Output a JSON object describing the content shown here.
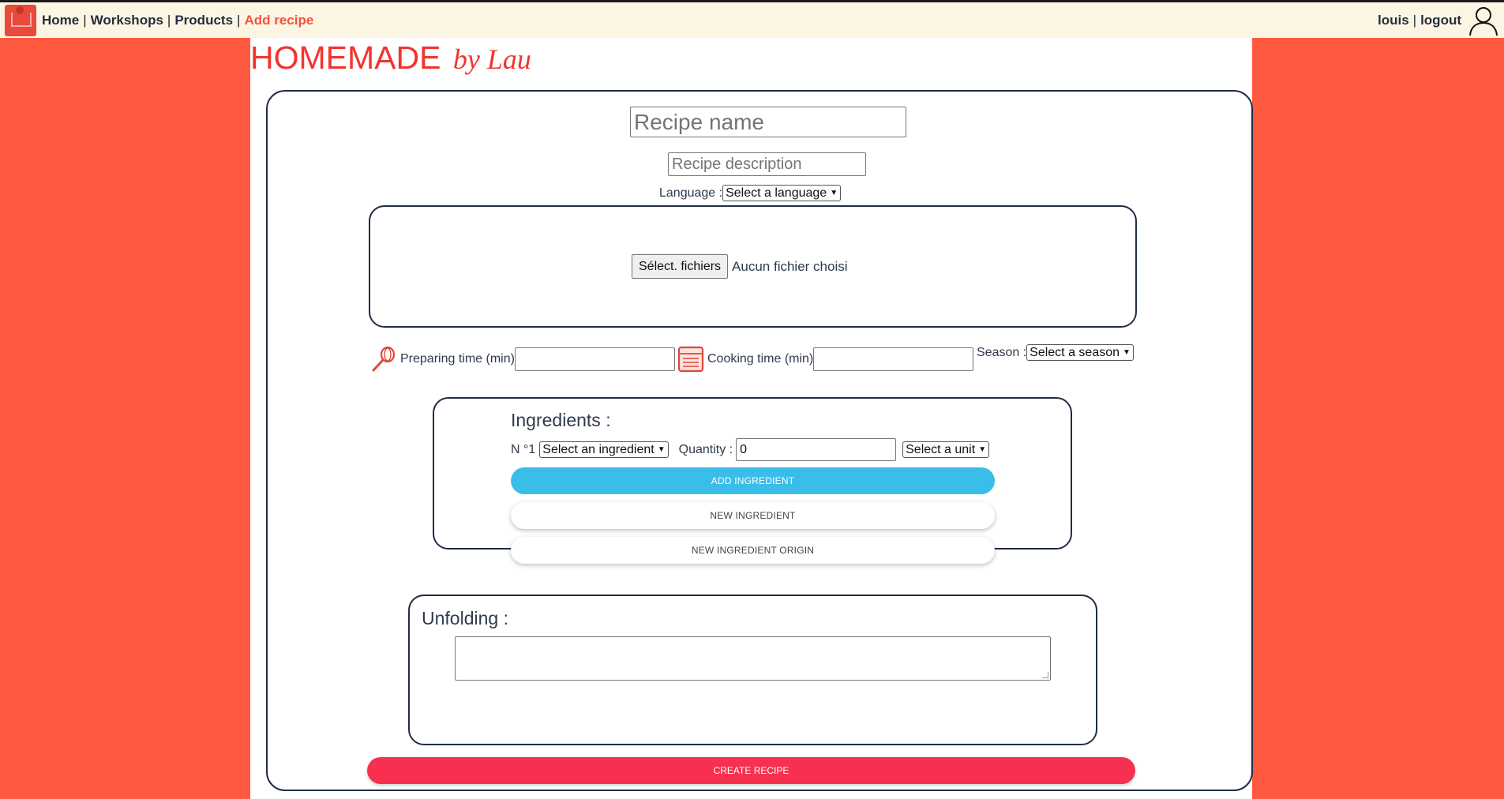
{
  "nav": {
    "home": "Home",
    "workshops": "Workshops",
    "products": "Products",
    "add_recipe": "Add recipe",
    "separator": "|"
  },
  "user": {
    "name": "louis",
    "logout": "logout"
  },
  "brand": {
    "main": "HOMEMADE",
    "script": "by Lau"
  },
  "form": {
    "recipe_name_placeholder": "Recipe name",
    "recipe_description_placeholder": "Recipe description",
    "language_label": "Language :",
    "language_select": "Select a language",
    "file_button": "Sélect. fichiers",
    "file_status": "Aucun fichier choisi",
    "preparing_label": "Preparing time (min)",
    "cooking_label": "Cooking time (min)",
    "season_label": "Season :",
    "season_select": "Select a season"
  },
  "ingredients": {
    "title": "Ingredients :",
    "number_label": "N °1",
    "ingredient_select": "Select an ingredient",
    "quantity_label": "Quantity :",
    "quantity_value": "0",
    "unit_select": "Select a unit",
    "add_button": "ADD INGREDIENT",
    "new_button": "NEW INGREDIENT",
    "new_origin_button": "NEW INGREDIENT ORIGIN"
  },
  "unfolding": {
    "title": "Unfolding :"
  },
  "create_button": "CREATE RECIPE",
  "icons": {
    "logo": "chef-logo-icon",
    "user": "user-icon",
    "whisk": "whisk-icon",
    "oven": "oven-icon"
  },
  "colors": {
    "page_background": "#ff5a3f",
    "topbar": "#fdf5e3",
    "brand_red": "#f2342e",
    "active_nav": "#f1543f",
    "add_button": "#3bbde9",
    "create_button": "#f7304f",
    "border_dark": "#1f2d44"
  }
}
